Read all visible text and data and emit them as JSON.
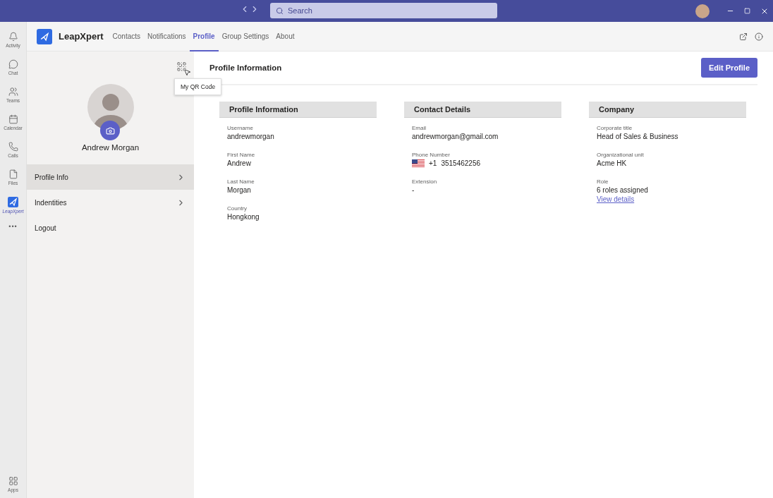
{
  "title_bar": {
    "search": {
      "placeholder": "Search"
    }
  },
  "rail": {
    "items": [
      {
        "kind": "activity",
        "label": "Activity",
        "selected": false
      },
      {
        "kind": "chat",
        "label": "Chat",
        "selected": false
      },
      {
        "kind": "teams",
        "label": "Teams",
        "selected": false
      },
      {
        "kind": "calendar",
        "label": "Calendar",
        "selected": false
      },
      {
        "kind": "calls",
        "label": "Calls",
        "selected": false
      },
      {
        "kind": "files",
        "label": "Files",
        "selected": false
      },
      {
        "kind": "app",
        "label": "LeapXpert",
        "selected": true
      }
    ],
    "more": "•••",
    "apps": {
      "label": "Apps"
    }
  },
  "app_header": {
    "brand": "LeapXpert",
    "tabs": [
      {
        "label": "Contacts",
        "selected": false
      },
      {
        "label": "Notifications",
        "selected": false
      },
      {
        "label": "Profile",
        "selected": true
      },
      {
        "label": "Group Settings",
        "selected": false
      },
      {
        "label": "About",
        "selected": false
      }
    ]
  },
  "profile_panel": {
    "tooltip": "My QR Code",
    "name": "Andrew Morgan",
    "menu": [
      {
        "label": "Profile Info",
        "selected": true,
        "kind": "expandable"
      },
      {
        "label": "Indentities",
        "selected": false,
        "kind": "expandable"
      },
      {
        "label": "Logout",
        "selected": false,
        "kind": "plain"
      }
    ]
  },
  "content": {
    "title": "Profile Information",
    "edit_button": "Edit Profile",
    "sections": [
      {
        "title": "Profile Information",
        "fields": [
          {
            "kind": "text",
            "label": "Username",
            "value": "andrewmorgan"
          },
          {
            "kind": "text",
            "label": "First Name",
            "value": "Andrew"
          },
          {
            "kind": "text",
            "label": "Last Name",
            "value": "Morgan"
          },
          {
            "kind": "text",
            "label": "Country",
            "value": "Hongkong"
          }
        ]
      },
      {
        "title": "Contact Details",
        "fields": [
          {
            "kind": "text",
            "label": "Email",
            "value": "andrewmorgan@gmail.com"
          },
          {
            "kind": "phone",
            "label": "Phone Number",
            "code": "+1",
            "value": "3515462256"
          },
          {
            "kind": "text",
            "label": "Extension",
            "value": "-"
          }
        ]
      },
      {
        "title": "Company",
        "fields": [
          {
            "kind": "text",
            "label": "Corporate title",
            "value": "Head of Sales & Business"
          },
          {
            "kind": "text",
            "label": "Organizational unit",
            "value": "Acme HK"
          },
          {
            "kind": "link",
            "label": "Role",
            "value": "6 roles assigned",
            "link": "View details"
          }
        ]
      }
    ]
  }
}
